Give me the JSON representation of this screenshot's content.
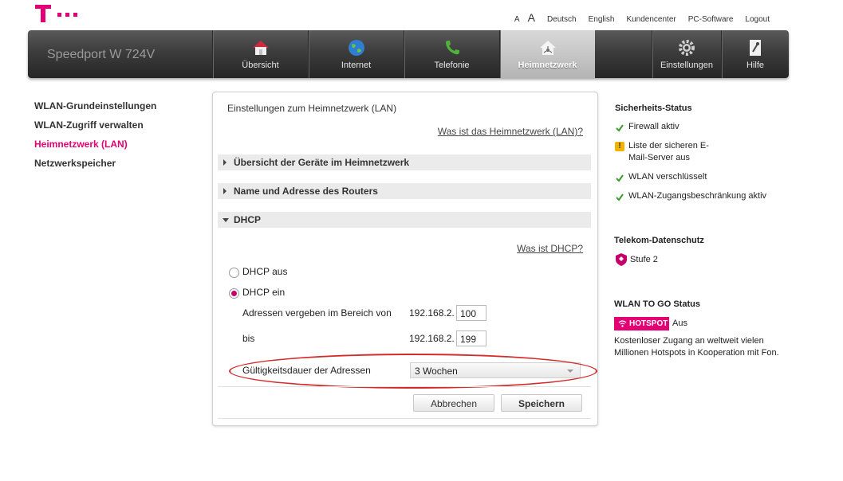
{
  "header": {
    "font_small": "A",
    "font_large": "A",
    "links": [
      "Deutsch",
      "English",
      "Kundencenter",
      "PC-Software",
      "Logout"
    ]
  },
  "nav": {
    "brand": "Speedport W 724V",
    "tabs": [
      {
        "label": "Übersicht",
        "icon": "house-icon"
      },
      {
        "label": "Internet",
        "icon": "globe-icon"
      },
      {
        "label": "Telefonie",
        "icon": "phone-icon"
      },
      {
        "label": "Heimnetzwerk",
        "icon": "home-network-icon",
        "active": true
      },
      {
        "label": "Einstellungen",
        "icon": "gear-icon"
      },
      {
        "label": "Hilfe",
        "icon": "help-book-icon"
      }
    ]
  },
  "sidebar": {
    "items": [
      "WLAN-Grundeinstellungen",
      "WLAN-Zugriff verwalten",
      "Heimnetzwerk (LAN)",
      "Netzwerkspeicher"
    ],
    "active_index": 2
  },
  "main": {
    "title": "Einstellungen zum Heimnetzwerk (LAN)",
    "help_link": "Was ist das Heimnetzwerk (LAN)?",
    "sections": [
      {
        "label": "Übersicht der Geräte im Heimnetzwerk",
        "expanded": false
      },
      {
        "label": "Name und Adresse des Routers",
        "expanded": false
      },
      {
        "label": "DHCP",
        "expanded": true
      }
    ],
    "dhcp": {
      "help_link": "Was ist DHCP?",
      "option_off": "DHCP aus",
      "option_on": "DHCP ein",
      "range_label": "Adressen vergeben im Bereich von",
      "to_label": "bis",
      "ip_prefix": "192.168.2.",
      "range_start": "100",
      "range_end": "199",
      "lease_label": "Gültigkeitsdauer der Adressen",
      "lease_value": "3 Wochen"
    },
    "buttons": {
      "cancel": "Abbrechen",
      "save": "Speichern"
    }
  },
  "right": {
    "security_title": "Sicherheits-Status",
    "security_items": [
      {
        "text": "Firewall aktiv",
        "status": "ok"
      },
      {
        "text": "Liste der sicheren E-Mail-Server aus",
        "status": "warning"
      },
      {
        "text": "WLAN verschlüsselt",
        "status": "ok"
      },
      {
        "text": "WLAN-Zugangsbeschränkung aktiv",
        "status": "ok"
      }
    ],
    "privacy_title": "Telekom-Datenschutz",
    "privacy_level": "Stufe 2",
    "wlan_togo_title": "WLAN TO GO Status",
    "hotspot_badge": "HOTSPOT",
    "hotspot_state": "Aus",
    "hotspot_desc": "Kostenloser Zugang an weltweit vielen Millionen Hotspots in Kooperation mit Fon."
  },
  "colors": {
    "brand_magenta": "#e20074",
    "highlight_ring": "#d42a2a",
    "check_green": "#3a9a2e"
  }
}
